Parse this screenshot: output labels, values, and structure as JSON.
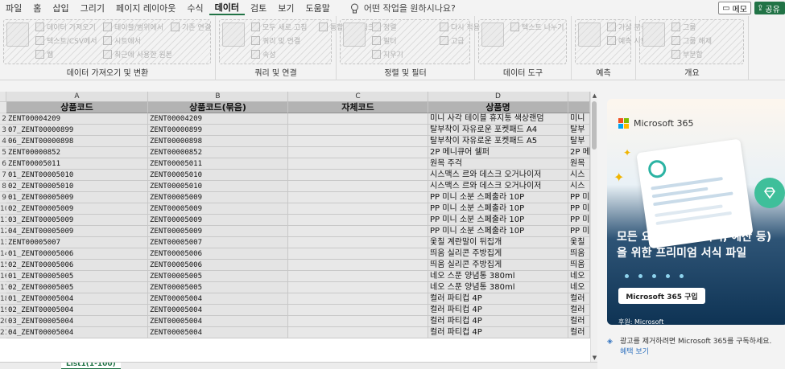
{
  "menu": {
    "tabs": [
      "파일",
      "홈",
      "삽입",
      "그리기",
      "페이지 레이아웃",
      "수식",
      "데이터",
      "검토",
      "보기",
      "도움말"
    ],
    "active_tab": "데이터",
    "tell_me": "어떤 작업을 원하시나요?",
    "memo": "메모",
    "share": "공유"
  },
  "ribbon": {
    "groups": [
      {
        "label": "데이터 가져오기 및 변환",
        "items": [
          "데이터 가져오기",
          "텍스트/CSV에서",
          "웹",
          "테이블/범위에서",
          "시트에서",
          "최근에 사용한 원본",
          "기존 연결"
        ]
      },
      {
        "label": "쿼리 및 연결",
        "items": [
          "모두 새로 고침",
          "쿼리 및 연결",
          "속성",
          "통합 문서 링크"
        ]
      },
      {
        "label": "정렬 및 필터",
        "items": [
          "정렬",
          "필터",
          "지우기",
          "다시 적용",
          "고급"
        ]
      },
      {
        "label": "데이터 도구",
        "items": [
          "텍스트 나누기"
        ]
      },
      {
        "label": "예측",
        "items": [
          "가상 분석",
          "예측 시트"
        ]
      },
      {
        "label": "개요",
        "items": [
          "그룹",
          "그룹 해제",
          "부분합"
        ]
      }
    ]
  },
  "sheet": {
    "columns": [
      "A",
      "B",
      "C",
      "D"
    ],
    "headers": [
      "상품코드",
      "상품코드(묶음)",
      "자체코드",
      "상품명"
    ],
    "rows": [
      {
        "num": "2",
        "a": "ZENT00004209",
        "b": "ZENT00004209",
        "c": "",
        "d": "미니 사각 테이블 휴지통 색상랜덤",
        "e": "미니"
      },
      {
        "num": "3",
        "a": "07_ZENT00000899",
        "b": "ZENT00000899",
        "c": "",
        "d": "탈부착이 자유로운 포켓패드 A4",
        "e": "탈부"
      },
      {
        "num": "4",
        "a": "06_ZENT00000898",
        "b": "ZENT00000898",
        "c": "",
        "d": "탈부착이 자유로운 포켓패드 A5",
        "e": "탈부"
      },
      {
        "num": "5",
        "a": "ZENT00000852",
        "b": "ZENT00000852",
        "c": "",
        "d": "2P 메니큐어 쉘퍼",
        "e": "2P 메"
      },
      {
        "num": "6",
        "a": "ZENT00005011",
        "b": "ZENT00005011",
        "c": "",
        "d": "원목 주걱",
        "e": "원목"
      },
      {
        "num": "7",
        "a": "01_ZENT00005010",
        "b": "ZENT00005010",
        "c": "",
        "d": "시스맥스 르와 데스크 오거나이저",
        "e": "시스"
      },
      {
        "num": "8",
        "a": "02_ZENT00005010",
        "b": "ZENT00005010",
        "c": "",
        "d": "시스맥스 르와 데스크 오거나이저",
        "e": "시스"
      },
      {
        "num": "9",
        "a": "01_ZENT00005009",
        "b": "ZENT00005009",
        "c": "",
        "d": "PP 미니 소분 스페출라 10P",
        "e": "PP 미"
      },
      {
        "num": "10",
        "a": "02_ZENT00005009",
        "b": "ZENT00005009",
        "c": "",
        "d": "PP 미니 소분 스페출라 10P",
        "e": "PP 미"
      },
      {
        "num": "11",
        "a": "03_ZENT00005009",
        "b": "ZENT00005009",
        "c": "",
        "d": "PP 미니 소분 스페출라 10P",
        "e": "PP 미"
      },
      {
        "num": "12",
        "a": "04_ZENT00005009",
        "b": "ZENT00005009",
        "c": "",
        "d": "PP 미니 소분 스페출라 10P",
        "e": "PP 미"
      },
      {
        "num": "13",
        "a": "ZENT00005007",
        "b": "ZENT00005007",
        "c": "",
        "d": "옻칠 계란말이 뒤집개",
        "e": "옻칠"
      },
      {
        "num": "14",
        "a": "01_ZENT00005006",
        "b": "ZENT00005006",
        "c": "",
        "d": "띄움 실리콘 주방집게",
        "e": "띄움"
      },
      {
        "num": "15",
        "a": "02_ZENT00005006",
        "b": "ZENT00005006",
        "c": "",
        "d": "띄움 실리콘 주방집게",
        "e": "띄움"
      },
      {
        "num": "16",
        "a": "01_ZENT00005005",
        "b": "ZENT00005005",
        "c": "",
        "d": "네오 스푼 양념통 380ml",
        "e": "네오"
      },
      {
        "num": "17",
        "a": "02_ZENT00005005",
        "b": "ZENT00005005",
        "c": "",
        "d": "네오 스푼 양념통 380ml",
        "e": "네오"
      },
      {
        "num": "18",
        "a": "01_ZENT00005004",
        "b": "ZENT00005004",
        "c": "",
        "d": "컬러 파티컵 4P",
        "e": "컬러"
      },
      {
        "num": "19",
        "a": "02_ZENT00005004",
        "b": "ZENT00005004",
        "c": "",
        "d": "컬러 파티컵 4P",
        "e": "컬러"
      },
      {
        "num": "20",
        "a": "03_ZENT00005004",
        "b": "ZENT00005004",
        "c": "",
        "d": "컬러 파티컵 4P",
        "e": "컬러"
      },
      {
        "num": "21",
        "a": "04_ZENT00005004",
        "b": "ZENT00005004",
        "c": "",
        "d": "컬러 파티컵 4P",
        "e": "컬러"
      }
    ],
    "sheet_tab": "List1(1-100)"
  },
  "ad": {
    "brand": "Microsoft 365",
    "headline_line1": "모든 요구 사항(이력서, 예산 등)",
    "headline_line2": "을 위한 프리미엄 서식 파일",
    "buy_button": "Microsoft 365 구입",
    "sponsor": "후원: Microsoft",
    "note": "광고를 제거하려면 Microsoft 365를 구독하세요.",
    "note_link": "혜택 보기"
  },
  "colors": {
    "accent": "#217346",
    "header_fill": "#b3b3b3",
    "cell_fill": "#e4e4e4",
    "ms_red": "#f25022",
    "ms_green": "#7fba00",
    "ms_blue": "#00a4ef",
    "ms_yellow": "#ffb900"
  },
  "icons": [
    "lightbulb-icon",
    "comment-icon",
    "share-icon",
    "filter-icon",
    "sort-icon",
    "diamond-icon",
    "microsoft-logo"
  ]
}
